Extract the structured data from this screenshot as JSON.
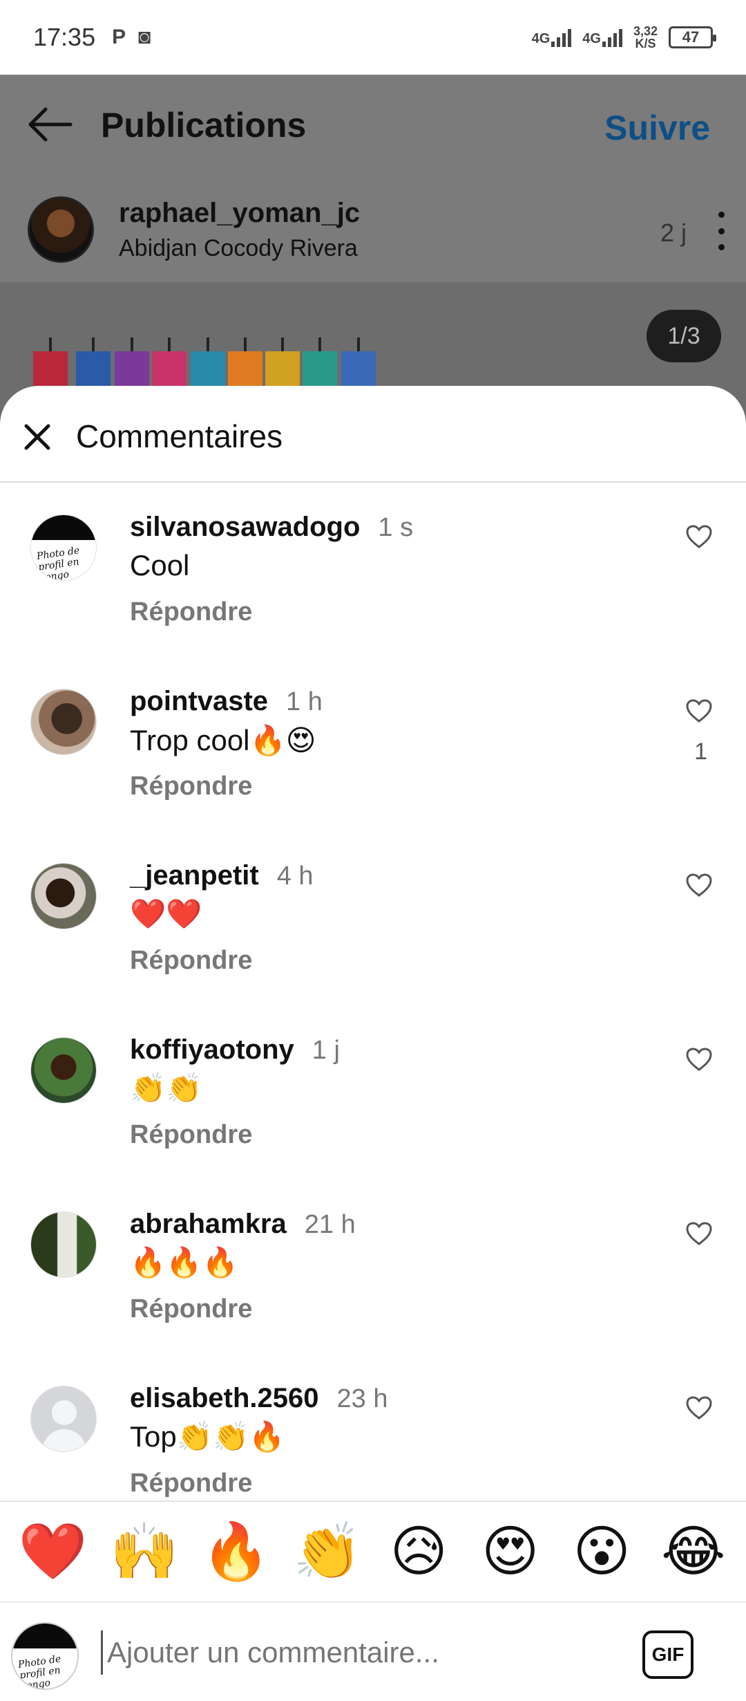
{
  "status_bar": {
    "time": "17:35",
    "left_icons": [
      "P",
      "◙"
    ],
    "network_1": "4G",
    "network_2": "4G",
    "speed_value": "3,32",
    "speed_unit": "K/S",
    "battery": "47"
  },
  "header": {
    "title": "Publications",
    "follow_label": "Suivre"
  },
  "post": {
    "author": "raphael_yoman_jc",
    "location": "Abidjan Cocody Rivera",
    "time": "2 j",
    "page_counter": "1/3"
  },
  "sheet": {
    "title": "Commentaires"
  },
  "comments": [
    {
      "user": "silvanosawadogo",
      "time": "1 s",
      "text": "Cool",
      "reply": "Répondre",
      "likes": "",
      "avatar_text": "Photo de profil en congo"
    },
    {
      "user": "pointvaste",
      "time": "1 h",
      "text": "Trop cool🔥😍",
      "reply": "Répondre",
      "likes": "1"
    },
    {
      "user": "_jeanpetit",
      "time": "4 h",
      "text": "❤️❤️",
      "reply": "Répondre",
      "likes": ""
    },
    {
      "user": "koffiyaotony",
      "time": "1 j",
      "text": "👏👏",
      "reply": "Répondre",
      "likes": ""
    },
    {
      "user": "abrahamkra",
      "time": "21 h",
      "text": "🔥🔥🔥",
      "reply": "Répondre",
      "likes": ""
    },
    {
      "user": "elisabeth.2560",
      "time": "23 h",
      "text": "Top👏👏🔥",
      "reply": "Répondre",
      "likes": ""
    }
  ],
  "emoji_bar": [
    "❤️",
    "🙌",
    "🔥",
    "👏",
    "😥",
    "😍",
    "😮",
    "😂"
  ],
  "composer": {
    "placeholder": "Ajouter un commentaire...",
    "gif_label": "GIF"
  },
  "colors": {
    "follow": "#0d4f86",
    "dim_overlay": "#7a7a7a",
    "muted_text": "#777777"
  }
}
